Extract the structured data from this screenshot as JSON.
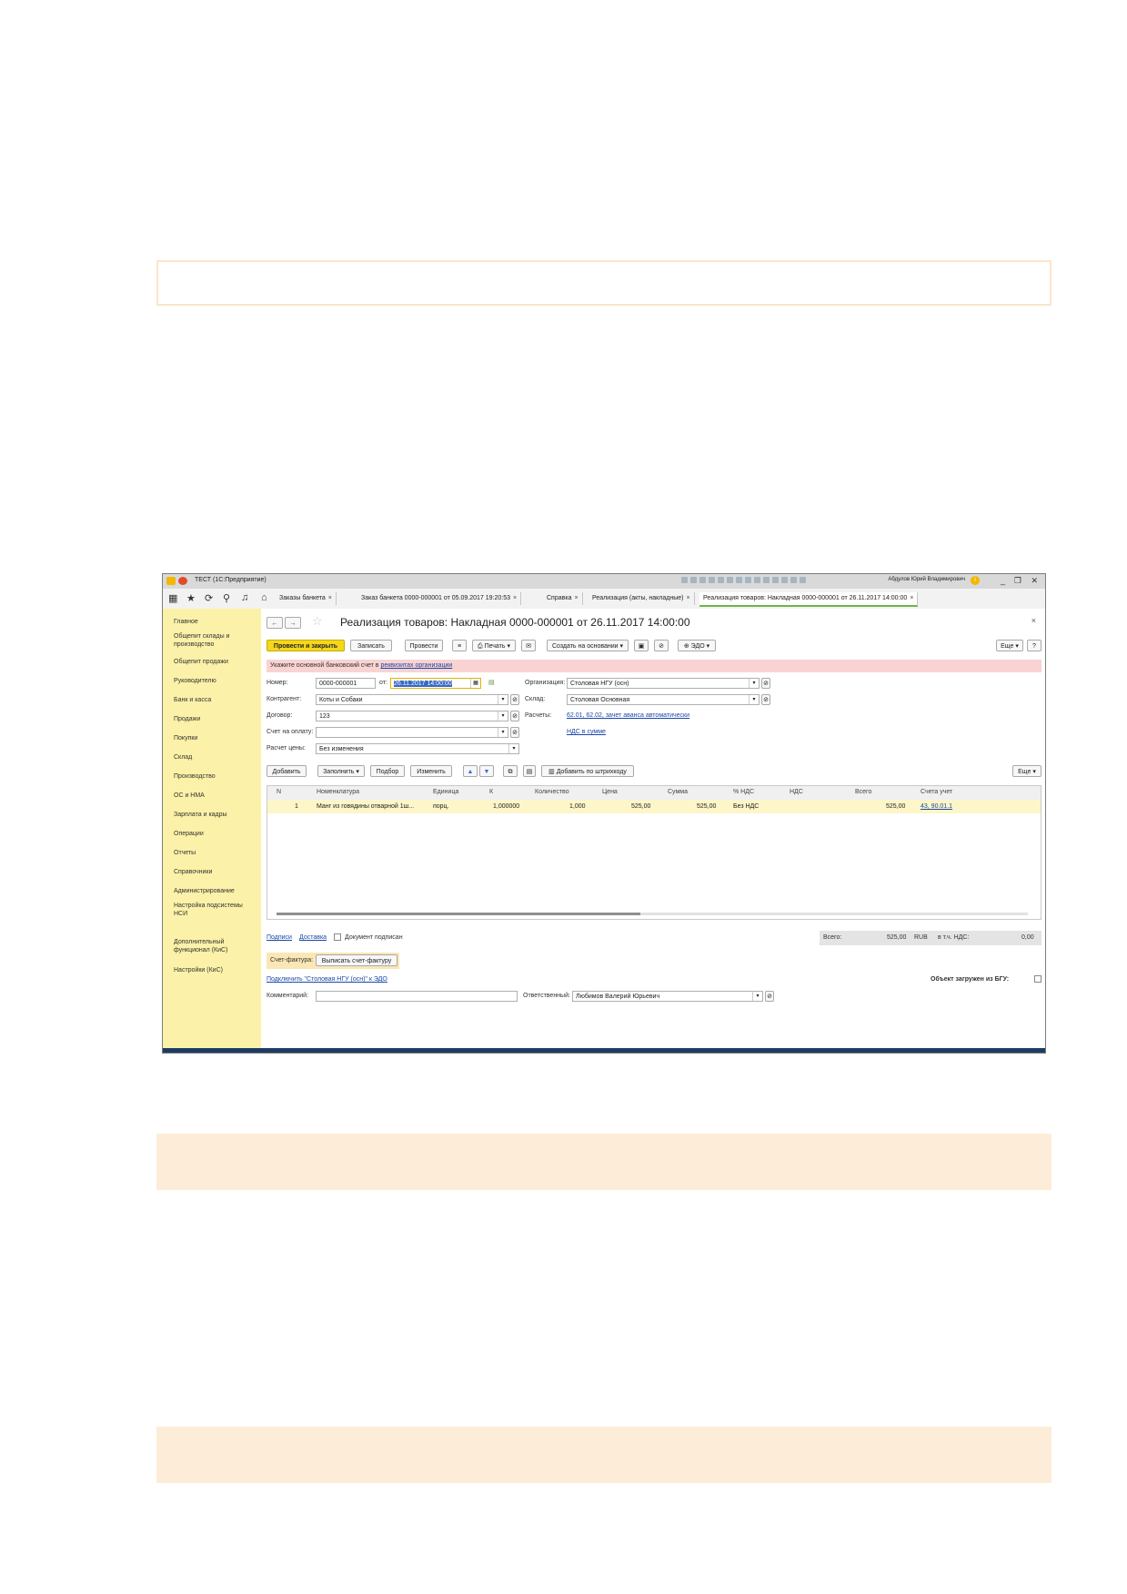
{
  "window": {
    "title": "ТЕСТ  (1С:Предприятие)",
    "user": "Абдулов Юрий Владимирович",
    "info_badge": "i"
  },
  "tabs": [
    {
      "label": "Заказы банкета",
      "close": "×"
    },
    {
      "label": "Заказ банкета 0000-000001 от 05.09.2017 19:20:53",
      "close": "×"
    },
    {
      "label": "Справка",
      "close": "×"
    },
    {
      "label": "Реализация (акты, накладные)",
      "close": "×"
    },
    {
      "label": "Реализация товаров: Накладная 0000-000001 от 26.11.2017 14:00:00",
      "close": "×"
    }
  ],
  "sidebar": {
    "items": [
      "Главное",
      "Общепит склады и производство",
      "Общепит продажи",
      "Руководителю",
      "Банк и касса",
      "Продажи",
      "Покупки",
      "Склад",
      "Производство",
      "ОС и НМА",
      "Зарплата и кадры",
      "Операции",
      "Отчеты",
      "Справочники",
      "Администрирование",
      "Настройка подсистемы НСИ",
      "Дополнительный функционал (КиС)",
      "Настройки (КиС)"
    ]
  },
  "doc": {
    "title": "Реализация товаров: Накладная 0000-000001 от 26.11.2017 14:00:00",
    "close": "×",
    "toolbar": {
      "post_close": "Провести и закрыть",
      "save": "Записать",
      "post": "Провести",
      "print": "Печать",
      "create_based": "Создать на основании",
      "edo": "ЭДО",
      "more": "Еще",
      "help": "?"
    },
    "warning": {
      "text": "Укажите основной банковский счет в ",
      "link": "реквизитах организации"
    },
    "fields": {
      "number_label": "Номер:",
      "number": "0000-000001",
      "date_label": "от:",
      "date": "26.11.2017 14:00:00",
      "org_label": "Организация:",
      "org": "Столовая НГУ (осн)",
      "counterparty_label": "Контрагент:",
      "counterparty": "Коты и Собаки",
      "warehouse_label": "Склад:",
      "warehouse": "Столовая Основная",
      "contract_label": "Договор:",
      "contract": "123",
      "settlements_label": "Расчеты:",
      "settlements": "62.01, 62.02, зачет аванса автоматически",
      "invoice_label": "Счет на оплату:",
      "invoice": "",
      "vat_link": "НДС в сумме",
      "price_calc_label": "Расчет цены:",
      "price_calc": "Без изменения"
    },
    "table_toolbar": {
      "add": "Добавить",
      "fill": "Заполнить",
      "pick": "Подбор",
      "change": "Изменить",
      "barcode": "Добавить по штрихкоду",
      "more": "Еще"
    },
    "columns": [
      "N",
      "Номенклатура",
      "Единица",
      "К",
      "Количество",
      "Цена",
      "Сумма",
      "% НДС",
      "НДС",
      "Всего",
      "Счета учет"
    ],
    "rows": [
      [
        "1",
        "Манг из говядины отварной 1ш...",
        "порц.",
        "1,000000",
        "1,000",
        "525,00",
        "525,00",
        "Без НДС",
        "",
        "525,00",
        "43, 90.01.1"
      ]
    ],
    "footer": {
      "signatures": "Подписи",
      "delivery": "Доставка",
      "signed": "Документ подписан",
      "total_label": "Всего:",
      "total": "525,00",
      "currency": "RUB",
      "vat_label": "в т.ч. НДС:",
      "vat": "0,00",
      "invoice_label": "Счет-фактура:",
      "invoice_btn": "Выписать счет-фактуру",
      "edo_link": "Подключить \"Столовая НГУ (осн)\" к ЭДО",
      "bgu_label": "Объект загружен из БГУ:",
      "comment_label": "Комментарий:",
      "comment": "",
      "responsible_label": "Ответственный:",
      "responsible": "Любимов Валерий Юрьевич"
    }
  }
}
